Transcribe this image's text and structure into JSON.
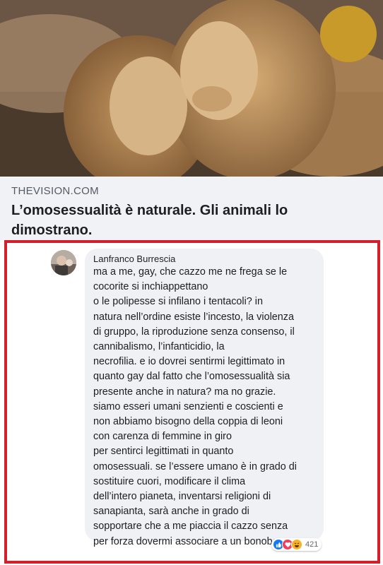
{
  "link_preview": {
    "image_icon": "lions-photo",
    "domain": "THEVISION.COM",
    "title": "L’omosessualità è naturale. Gli animali lo dimostrano."
  },
  "comment": {
    "author": "Lanfranco Burrescia",
    "avatar_icon": "user-avatar",
    "text": "ma a me, gay, che cazzo me ne frega se le\ncocorite si inchiappettano\no le polipesse si infilano i tentacoli? in\nnatura nell’ordine esiste l’incesto, la violenza\ndi gruppo, la riproduzione senza consenso, il\ncannibalismo, l’infanticidio, la\nnecrofilia. e io dovrei sentirmi legittimato in\nquanto gay dal fatto che l’omosessualità sia\npresente anche in natura? ma no grazie.\nsiamo esseri umani senzienti e coscienti e\nnon abbiamo bisogno della coppia di leoni\ncon carenza di femmine in giro\nper sentirci legittimati in quanto\nomosessuali. se l’essere umano è in grado di\nsostituire cuori, modificare il clima\ndell’intero pianeta, inventarsi religioni di\nsanapianta, sarà anche in grado di\nsopportare che a me piaccia il cazzo senza\nper forza dovermi associare a un bonobo.",
    "reactions": {
      "icons": [
        "like-icon",
        "love-icon",
        "haha-icon"
      ],
      "count": "421"
    }
  },
  "colors": {
    "highlight_frame": "#d21f2b",
    "bubble": "#eff1f4",
    "meta_background": "#f0f2f5"
  }
}
